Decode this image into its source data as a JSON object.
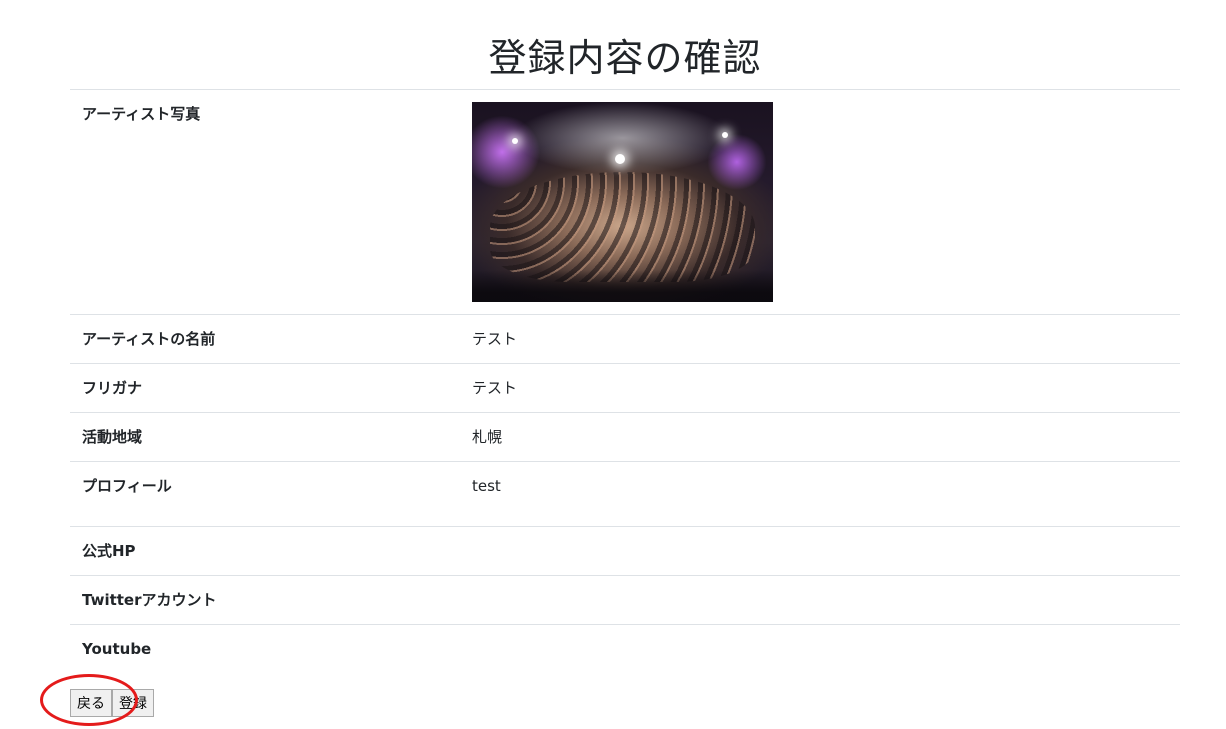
{
  "page": {
    "title": "登録内容の確認"
  },
  "fields": [
    {
      "label": "アーティスト写真",
      "value": ""
    },
    {
      "label": "アーティストの名前",
      "value": "テスト"
    },
    {
      "label": "フリガナ",
      "value": "テスト"
    },
    {
      "label": "活動地域",
      "value": "札幌"
    },
    {
      "label": "プロフィール",
      "value": "test"
    },
    {
      "label": "公式HP",
      "value": ""
    },
    {
      "label": "Twitterアカウント",
      "value": ""
    },
    {
      "label": "Youtube",
      "value": ""
    }
  ],
  "buttons": {
    "back_label": "戻る",
    "register_label": "登録"
  },
  "colors": {
    "annotation": "#e41b1b",
    "border": "#dee2e6"
  }
}
